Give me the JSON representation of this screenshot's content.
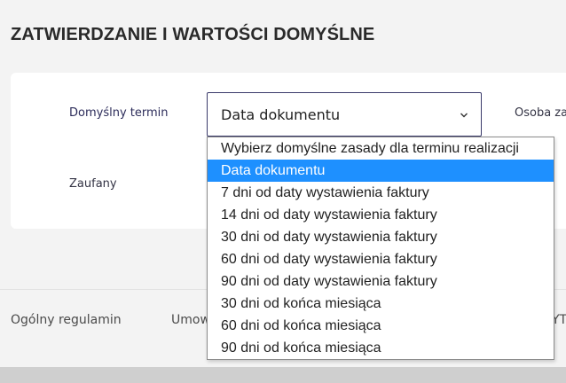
{
  "section": {
    "title": "ZATWIERDZANIE I WARTOŚCI DOMYŚLNE"
  },
  "form": {
    "term_label": "Domyślny termin",
    "trusted_label": "Zaufany",
    "person_label": "Osoba zat",
    "term_select": {
      "value": "Data dokumentu",
      "icon": "chevron-down-icon",
      "options": [
        "Wybierz domyślne zasady dla terminu realizacji",
        "Data dokumentu",
        "7 dni od daty wystawienia faktury",
        "14 dni od daty wystawienia faktury",
        "30 dni od daty wystawienia faktury",
        "60 dni od daty wystawienia faktury",
        "90 dni od daty wystawienia faktury",
        "30 dni od końca miesiąca",
        "60 dni od końca miesiąca",
        "90 dni od końca miesiąca"
      ],
      "selected_index": 1
    }
  },
  "footer": {
    "links": [
      "Ogólny regulamin",
      "Umow",
      "YT"
    ]
  },
  "colors": {
    "accent": "#1e90ff",
    "select_border": "#3a3a6a",
    "background": "#f3f3f3"
  }
}
